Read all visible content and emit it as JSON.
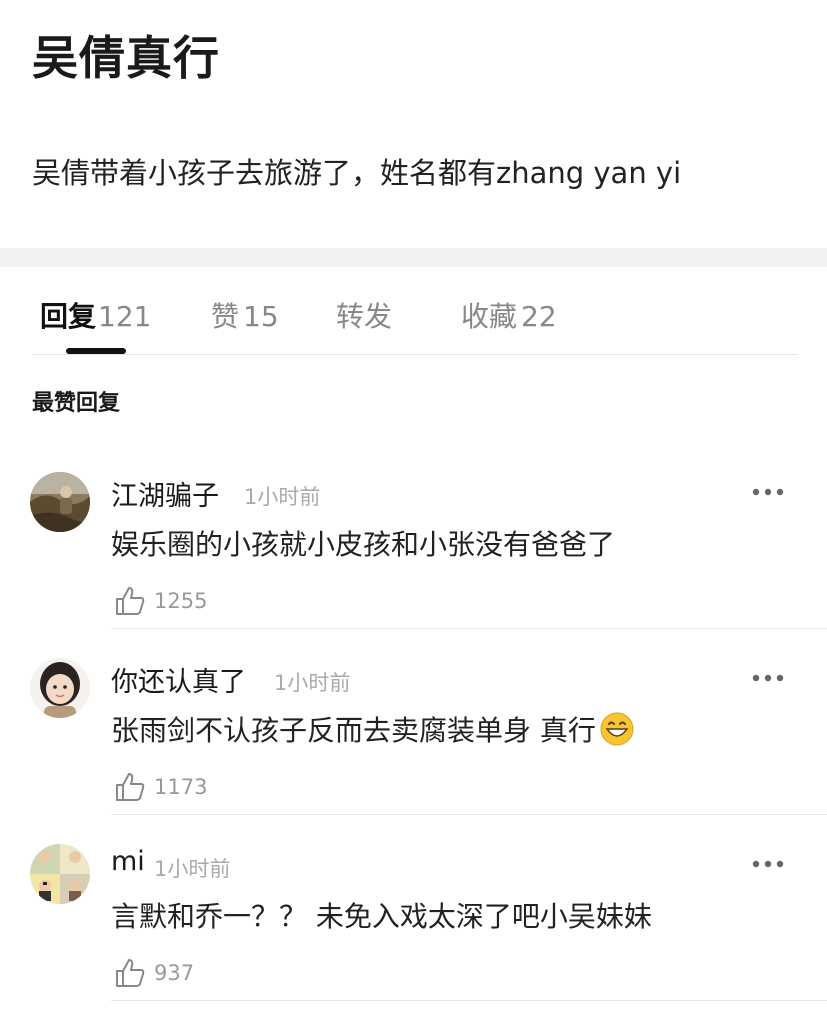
{
  "post": {
    "title": "吴倩真行",
    "body": "吴倩带着小孩子去旅游了，姓名都有zhang yan yi"
  },
  "tabs": [
    {
      "label": "回复",
      "count": "121",
      "active": true
    },
    {
      "label": "赞",
      "count": "15",
      "active": false
    },
    {
      "label": "转发",
      "count": "",
      "active": false
    },
    {
      "label": "收藏",
      "count": "22",
      "active": false
    }
  ],
  "section_title": "最赞回复",
  "comments": [
    {
      "name": "江湖骗子",
      "time": "1小时前",
      "text": "娱乐圈的小孩就小皮孩和小张没有爸爸了",
      "likes": "1255",
      "avatar_icon": "landscape-photo-avatar",
      "emoji": false
    },
    {
      "name": "你还认真了",
      "time": "1小时前",
      "text": "张雨剑不认孩子反而去卖腐装单身 真行",
      "likes": "1173",
      "avatar_icon": "child-portrait-avatar",
      "emoji": true
    },
    {
      "name": "mi",
      "time": "1小时前",
      "text": "言默和乔一？？ 未免入戏太深了吧小吴妹妹",
      "likes": "937",
      "avatar_icon": "cartoon-collage-avatar",
      "emoji": false
    }
  ],
  "colors": {
    "primary_text": "#1a1a1a",
    "secondary_text": "#888888",
    "muted_text": "#aaaaaa",
    "band": "#f1f1f1",
    "divider": "#e6e6e6"
  }
}
